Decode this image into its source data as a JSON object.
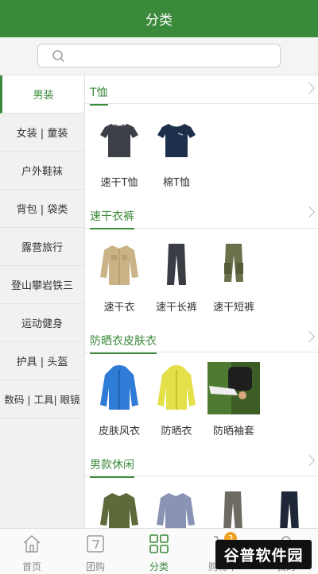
{
  "header": {
    "title": "分类"
  },
  "search": {
    "placeholder": ""
  },
  "sidebar": {
    "items": [
      {
        "label": "男装"
      },
      {
        "label": "女装 | 童装"
      },
      {
        "label": "户外鞋袜"
      },
      {
        "label": "背包 | 袋类"
      },
      {
        "label": "露营旅行"
      },
      {
        "label": "登山攀岩铁三"
      },
      {
        "label": "运动健身"
      },
      {
        "label": "护具 | 头盔"
      },
      {
        "label": "数码 | 工具| 眼镜"
      }
    ]
  },
  "sections": [
    {
      "title": "T恤",
      "products": [
        {
          "name": "速干T恤",
          "icon": "tshirt-gray"
        },
        {
          "name": "棉T恤",
          "icon": "tshirt-navy"
        }
      ]
    },
    {
      "title": "速干衣裤",
      "products": [
        {
          "name": "速干衣",
          "icon": "shirt-khaki"
        },
        {
          "name": "速干长裤",
          "icon": "pants-dark"
        },
        {
          "name": "速干短裤",
          "icon": "shorts-olive"
        }
      ]
    },
    {
      "title": "防晒衣皮肤衣",
      "products": [
        {
          "name": "皮肤风衣",
          "icon": "jacket-blue"
        },
        {
          "name": "防晒衣",
          "icon": "jacket-yellow"
        },
        {
          "name": "防晒袖套",
          "icon": "sleeve-photo"
        }
      ]
    },
    {
      "title": "男款休闲",
      "products": [
        {
          "name": "",
          "icon": "shirt-olive"
        },
        {
          "name": "",
          "icon": "shirt-check"
        },
        {
          "name": "",
          "icon": "pants-gray"
        },
        {
          "name": "",
          "icon": "pants-navy"
        }
      ]
    }
  ],
  "tabbar": {
    "items": [
      {
        "label": "首页",
        "icon": "home-icon"
      },
      {
        "label": "团购",
        "icon": "group-buy-icon"
      },
      {
        "label": "分类",
        "icon": "category-icon"
      },
      {
        "label": "购物车",
        "icon": "cart-icon",
        "badge": "3"
      },
      {
        "label": "我的",
        "icon": "user-icon"
      }
    ]
  },
  "watermark": {
    "text": "谷普软件园"
  },
  "colors": {
    "accent": "#3b8a3b"
  }
}
